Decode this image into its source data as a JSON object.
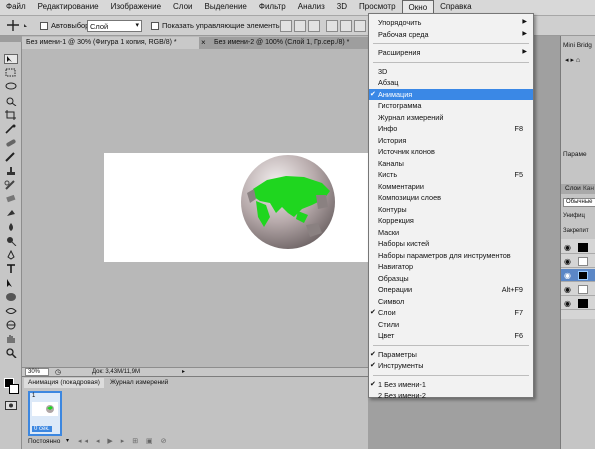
{
  "menubar": [
    "Файл",
    "Редактирование",
    "Изображение",
    "Слои",
    "Выделение",
    "Фильтр",
    "Анализ",
    "3D",
    "Просмотр",
    "Окно",
    "Справка"
  ],
  "options": {
    "autoselect_label": "Автовыбор:",
    "autoselect_value": "Слой",
    "show_controls_label": "Показать управляющие элементы"
  },
  "tabs": [
    "Без имени-1 @ 30% (Фигура 1 копия, RGB/8) *",
    "Без имени-2 @ 100% (Слой 1, Гр.сер./8) *"
  ],
  "status": {
    "zoom": "30%",
    "doc": "Док: 3,43M/11,9M"
  },
  "anim_panel": {
    "tab1": "Анимация (покадровая)",
    "tab2": "Журнал измерений",
    "frame_number": "1",
    "frame_delay": "0 сек.",
    "loop": "Постоянно"
  },
  "right": {
    "mini_bridge": "Mini Bridg",
    "params": "Параме",
    "layers_tab": "Слои",
    "cnl_tab": "Кан",
    "blend": "Обычные",
    "unify": "Унифиц",
    "lock": "Закрепит"
  },
  "window_menu": {
    "items": [
      {
        "label": "Упорядочить",
        "submenu": true
      },
      {
        "label": "Рабочая среда",
        "submenu": true
      },
      {
        "sep": true
      },
      {
        "label": "Расширения",
        "submenu": true
      },
      {
        "sep": true
      },
      {
        "label": "3D"
      },
      {
        "label": "Абзац"
      },
      {
        "label": "Анимация",
        "checked": true,
        "highlight": true
      },
      {
        "label": "Гистограмма"
      },
      {
        "label": "Журнал измерений"
      },
      {
        "label": "Инфо",
        "shortcut": "F8"
      },
      {
        "label": "История"
      },
      {
        "label": "Источник клонов"
      },
      {
        "label": "Каналы"
      },
      {
        "label": "Кисть",
        "shortcut": "F5"
      },
      {
        "label": "Комментарии"
      },
      {
        "label": "Композиции слоев"
      },
      {
        "label": "Контуры"
      },
      {
        "label": "Коррекция"
      },
      {
        "label": "Маски"
      },
      {
        "label": "Наборы кистей"
      },
      {
        "label": "Наборы параметров для инструментов"
      },
      {
        "label": "Навигатор"
      },
      {
        "label": "Образцы"
      },
      {
        "label": "Операции",
        "shortcut": "Alt+F9"
      },
      {
        "label": "Символ"
      },
      {
        "label": "Слои",
        "checked": true,
        "shortcut": "F7"
      },
      {
        "label": "Стили"
      },
      {
        "label": "Цвет",
        "shortcut": "F6"
      },
      {
        "sep": true
      },
      {
        "label": "Параметры",
        "checked": true
      },
      {
        "label": "Инструменты",
        "checked": true
      },
      {
        "sep": true
      },
      {
        "label": "1 Без имени-1",
        "checked": true
      },
      {
        "label": "2 Без имени-2"
      }
    ]
  },
  "colors": {
    "highlight": "#3a88e6",
    "globe_green": "#1fd61f"
  }
}
